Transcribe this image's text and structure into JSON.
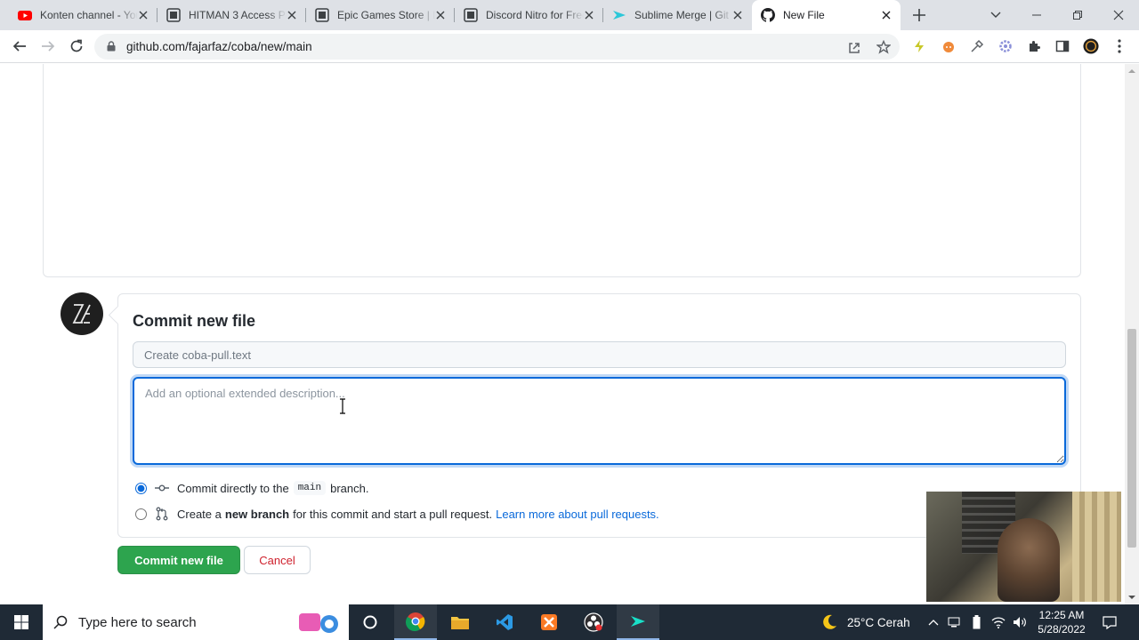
{
  "browser": {
    "tabs": [
      {
        "label": "Konten channel - YouTube",
        "icon": "youtube-icon"
      },
      {
        "label": "HITMAN 3 Access Pass",
        "icon": "hitman-icon"
      },
      {
        "label": "Epic Games Store | Download",
        "icon": "epic-games-icon"
      },
      {
        "label": "Discord Nitro for Free",
        "icon": "discord-icon"
      },
      {
        "label": "Sublime Merge | Git Client",
        "icon": "sublime-icon"
      },
      {
        "label": "New File",
        "icon": "github-icon",
        "active": true
      }
    ],
    "url": "github.com/fajarfaz/coba/new/main"
  },
  "commit": {
    "title": "Commit new file",
    "summary_placeholder": "Create coba-pull.text",
    "description_placeholder": "Add an optional extended description...",
    "option_direct": {
      "prefix": "Commit directly to the",
      "branch": "main",
      "suffix": "branch.",
      "selected": true
    },
    "option_new_branch": {
      "prefix": "Create a",
      "bold": "new branch",
      "middle": "for this commit and start a pull request.",
      "link": "Learn more about pull requests."
    },
    "commit_button": "Commit new file",
    "cancel_button": "Cancel"
  },
  "taskbar": {
    "search_placeholder": "Type here to search",
    "weather": "25°C  Cerah",
    "time": "12:25 AM",
    "date": "5/28/2022"
  },
  "colors": {
    "accent": "#0969da",
    "primary_button": "#2da44e",
    "cancel_text": "#cf222e"
  }
}
